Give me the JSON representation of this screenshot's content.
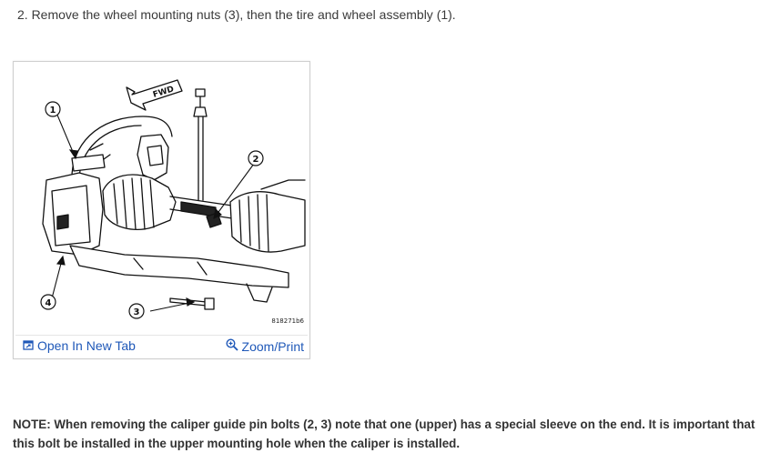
{
  "step": {
    "text": "2. Remove the wheel mounting nuts (3), then the tire and wheel assembly (1)."
  },
  "figure": {
    "fwd_label": "FWD",
    "callouts": [
      "1",
      "2",
      "3",
      "4"
    ],
    "figure_id": "818271b6",
    "links": {
      "open_new_tab": "Open In New Tab",
      "zoom_print": "Zoom/Print"
    },
    "link_color": "#1f58b8"
  },
  "note": {
    "text": "NOTE:  When removing the caliper guide pin bolts (2, 3) note that one (upper) has a special sleeve on the end. It is important that this bolt be installed in the upper mounting hole when the caliper is installed."
  }
}
